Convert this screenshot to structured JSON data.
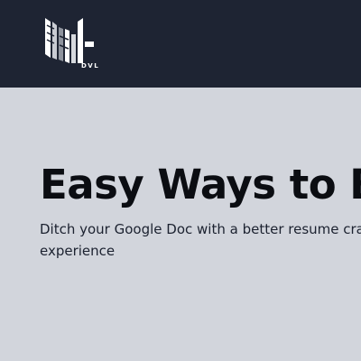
{
  "navbar": {
    "logo_text": "DVL",
    "background": "#1e2433"
  },
  "hero": {
    "title": "Easy Ways to Bu",
    "subtitle": "Ditch your Google Doc with a better resume crafting experience",
    "background": "#d2d5dc"
  }
}
